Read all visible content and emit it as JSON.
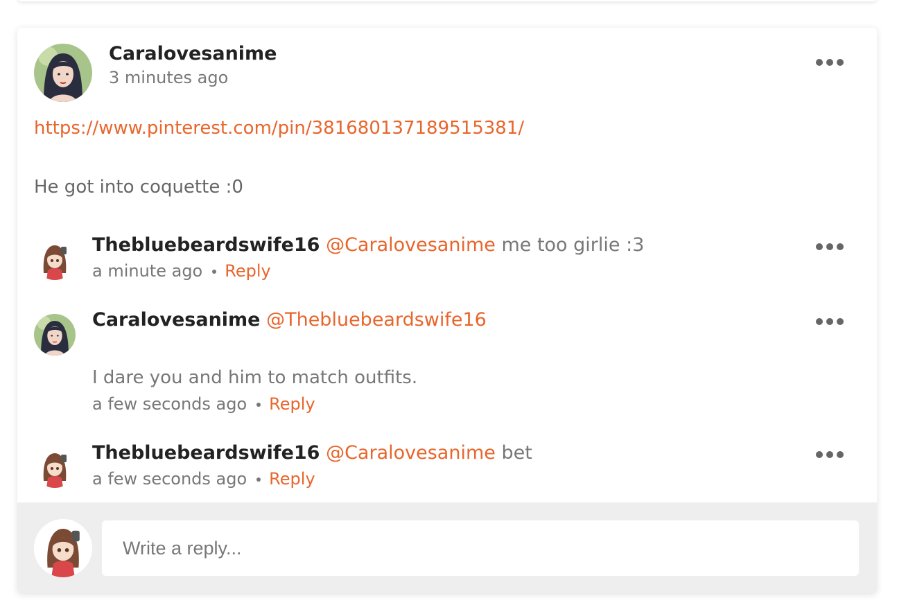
{
  "post": {
    "author": "Caralovesanime",
    "time": "3 minutes ago",
    "link": "https://www.pinterest.com/pin/381680137189515381/",
    "text": "He got into coquette :0"
  },
  "comments": [
    {
      "author": "Thebluebeardswife16",
      "mention": "@Caralovesanime",
      "text": " me too girlie :3",
      "time": "a minute ago",
      "reply_label": "Reply"
    },
    {
      "author": "Caralovesanime",
      "mention": "@Thebluebeardswife16",
      "text": "",
      "body": "I dare you and him to match outfits.",
      "time": "a few seconds ago",
      "reply_label": "Reply"
    },
    {
      "author": "Thebluebeardswife16",
      "mention": "@Caralovesanime",
      "text": " bet",
      "time": "a few seconds ago",
      "reply_label": "Reply"
    }
  ],
  "reply_box": {
    "placeholder": "Write a reply..."
  },
  "colors": {
    "accent": "#e8652b",
    "muted_text": "#777777",
    "reply_bar_bg": "#eeeeee"
  },
  "icons": {
    "more": "more-options-icon",
    "avatar_photo": "user-photo-avatar",
    "avatar_cartoon": "cartoon-girl-avatar"
  }
}
